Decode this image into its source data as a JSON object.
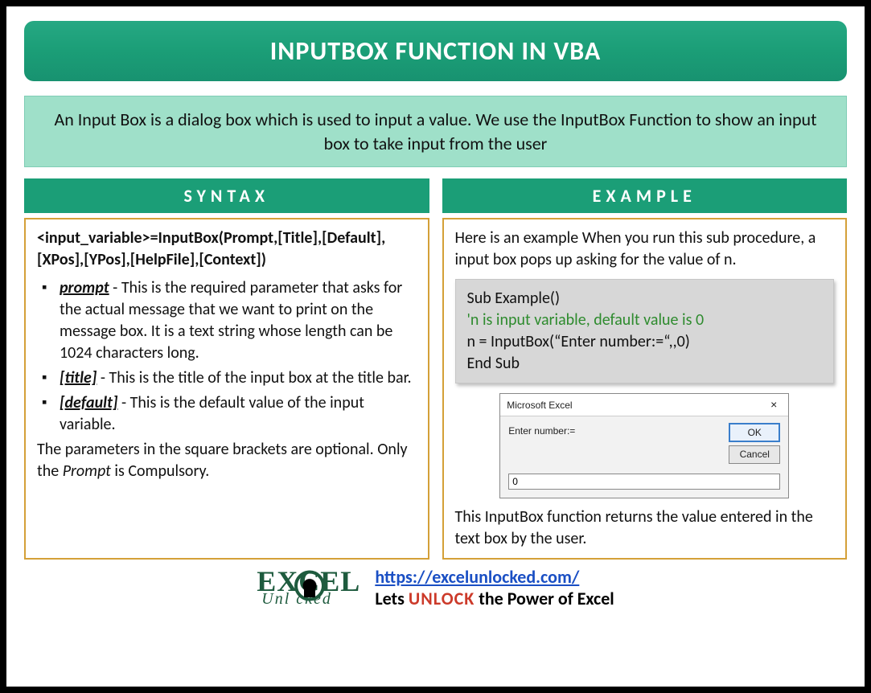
{
  "title": "INPUTBOX FUNCTION IN VBA",
  "intro": "An Input Box is a dialog box which is used to input a value. We use the InputBox Function to show an input box to take input from the user",
  "syntax": {
    "header": "SYNTAX",
    "signature": "<input_variable>=InputBox(Prompt,[Title],[Default],[XPos],[YPos],[HelpFile],[Context])",
    "params": [
      {
        "name": "prompt",
        "dash": " - ",
        "desc": "This is the required parameter that asks for the actual message that we want to print on the message box. It is a text string whose length can be 1024 characters long."
      },
      {
        "name": "[title]",
        "dash": " - ",
        "desc": "This is the title of the input box at the title bar."
      },
      {
        "name": "[default]",
        "dash": " - ",
        "desc": "This is the default value of the input variable."
      }
    ],
    "note_1": "The parameters in the square brackets are optional. Only the ",
    "note_em": "Prompt",
    "note_2": " is Compulsory."
  },
  "example": {
    "header": "EXAMPLE",
    "intro": "Here is an example When you run this sub procedure, a input box pops up asking for the value of n.",
    "code": {
      "line1": "Sub Example()",
      "comment": "'n is input variable, default value is 0",
      "line3": "n = InputBox(“Enter number:=“,,0)",
      "line4": "End Sub"
    },
    "dialog": {
      "title": "Microsoft Excel",
      "prompt": "Enter number:=",
      "ok": "OK",
      "cancel": "Cancel",
      "value": "0"
    },
    "outro": "This InputBox function returns the value entered in the text box by the user."
  },
  "footer": {
    "logo_top_1": "EX",
    "logo_top_2": "C",
    "logo_top_3": "EL",
    "logo_bottom": "Unl  cked",
    "url": "https://excelunlocked.com/",
    "tag_1": "Lets ",
    "tag_unlock": "UNLOCK",
    "tag_2": " the Power of Excel"
  }
}
